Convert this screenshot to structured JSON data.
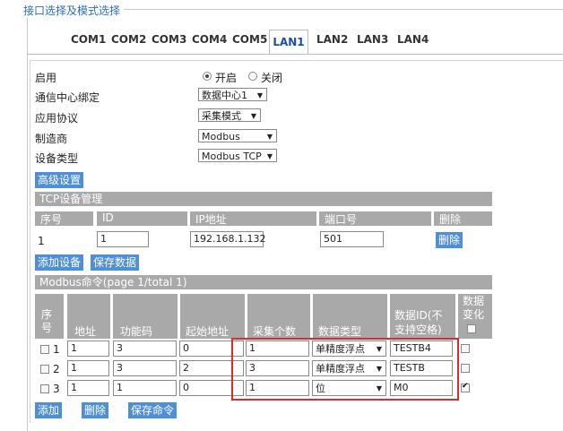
{
  "section_title": "接口选择及模式选择",
  "tabs": [
    "COM1",
    "COM2",
    "COM3",
    "COM4",
    "COM5",
    "LAN1",
    "LAN2",
    "LAN3",
    "LAN4"
  ],
  "active_tab": "LAN1",
  "form": {
    "enable_label": "启用",
    "enable_on": "开启",
    "enable_off": "关闭",
    "enabled": true,
    "channel_label": "通信中心绑定",
    "channel_value": "数据中心1",
    "protocol_label": "应用协议",
    "protocol_value": "采集模式",
    "vendor_label": "制造商",
    "vendor_value": "Modbus",
    "device_type_label": "设备类型",
    "device_type_value": "Modbus TCP"
  },
  "buttons": {
    "advanced": "高级设置",
    "add_device": "添加设备",
    "save_data": "保存数据",
    "delete": "删除",
    "add": "添加",
    "delete2": "删除",
    "save_cmd": "保存命令"
  },
  "tcp": {
    "title": "TCP设备管理",
    "headers": [
      "序号",
      "ID",
      "IP地址",
      "端口号",
      "删除"
    ],
    "row": {
      "index": "1",
      "id": "1",
      "ip": "192.168.1.132",
      "port": "501"
    }
  },
  "modbus": {
    "title": "Modbus命令(page 1/total 1)",
    "headers": {
      "seq": "序号",
      "addr": "地址",
      "func": "功能码",
      "start": "起始地址",
      "count": "采集个数",
      "dtype": "数据类型",
      "dataid": "数据ID(不支持空格)",
      "change": "数据变化"
    },
    "rows": [
      {
        "seq": "1",
        "addr": "1",
        "func": "3",
        "start": "0",
        "count": "1",
        "dtype": "单精度浮点",
        "dataid": "TESTB4",
        "checked": false,
        "change": false
      },
      {
        "seq": "2",
        "addr": "1",
        "func": "3",
        "start": "2",
        "count": "3",
        "dtype": "单精度浮点",
        "dataid": "TESTB",
        "checked": false,
        "change": false
      },
      {
        "seq": "3",
        "addr": "1",
        "func": "1",
        "start": "0",
        "count": "1",
        "dtype": "位",
        "dataid": "M0",
        "checked": false,
        "change": true
      }
    ]
  }
}
